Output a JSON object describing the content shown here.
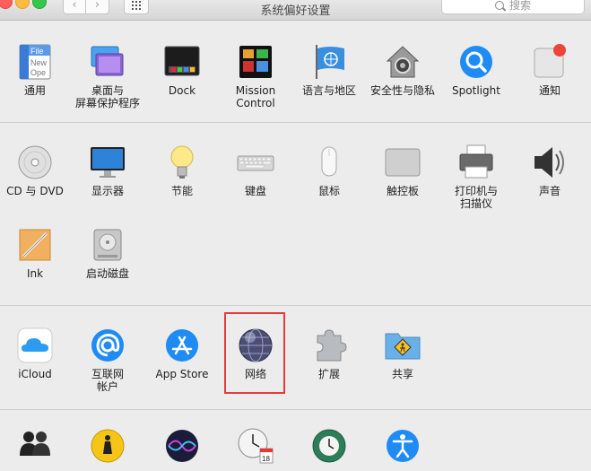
{
  "window": {
    "title": "系统偏好设置"
  },
  "search": {
    "placeholder": "搜索"
  },
  "toolbar": {
    "back_glyph": "‹",
    "forward_glyph": "›"
  },
  "rows": {
    "row1": [
      {
        "id": "general",
        "label": "通用",
        "icon": "general-file-icon"
      },
      {
        "id": "desktop",
        "label": "桌面与\n屏幕保护程序",
        "icon": "desktop-screensaver-icon"
      },
      {
        "id": "dock",
        "label": "Dock",
        "icon": "dock-icon"
      },
      {
        "id": "mission",
        "label": "Mission\nControl",
        "icon": "mission-control-icon"
      },
      {
        "id": "language",
        "label": "语言与地区",
        "icon": "language-region-icon"
      },
      {
        "id": "security",
        "label": "安全性与隐私",
        "icon": "security-house-icon"
      },
      {
        "id": "spotlight",
        "label": "Spotlight",
        "icon": "spotlight-icon"
      },
      {
        "id": "notifications",
        "label": "通知",
        "icon": "notifications-icon"
      }
    ],
    "row2": [
      {
        "id": "cddvd",
        "label": "CD 与 DVD",
        "icon": "cd-dvd-icon"
      },
      {
        "id": "displays",
        "label": "显示器",
        "icon": "display-icon"
      },
      {
        "id": "energy",
        "label": "节能",
        "icon": "lightbulb-icon"
      },
      {
        "id": "keyboard",
        "label": "键盘",
        "icon": "keyboard-icon"
      },
      {
        "id": "mouse",
        "label": "鼠标",
        "icon": "mouse-icon"
      },
      {
        "id": "trackpad",
        "label": "触控板",
        "icon": "trackpad-icon"
      },
      {
        "id": "printers",
        "label": "打印机与\n扫描仪",
        "icon": "printer-icon"
      },
      {
        "id": "sound",
        "label": "声音",
        "icon": "speaker-icon"
      }
    ],
    "row3": [
      {
        "id": "ink",
        "label": "Ink",
        "icon": "ink-pen-icon"
      },
      {
        "id": "startup",
        "label": "启动磁盘",
        "icon": "startup-disk-icon"
      }
    ],
    "row4": [
      {
        "id": "icloud",
        "label": "iCloud",
        "icon": "icloud-icon"
      },
      {
        "id": "internet",
        "label": "互联网\n帐户",
        "icon": "internet-accounts-icon"
      },
      {
        "id": "appstore",
        "label": "App Store",
        "icon": "app-store-icon"
      },
      {
        "id": "network",
        "label": "网络",
        "icon": "network-globe-icon"
      },
      {
        "id": "extensions",
        "label": "扩展",
        "icon": "extensions-puzzle-icon"
      },
      {
        "id": "sharing",
        "label": "共享",
        "icon": "sharing-folder-icon"
      }
    ]
  },
  "icon_text": {
    "general_file": "File",
    "general_new": "New",
    "general_ope": "Ope",
    "calendar_day": "18"
  },
  "colors": {
    "highlight": "#e53c3c",
    "accent_blue": "#1f8bf5"
  }
}
